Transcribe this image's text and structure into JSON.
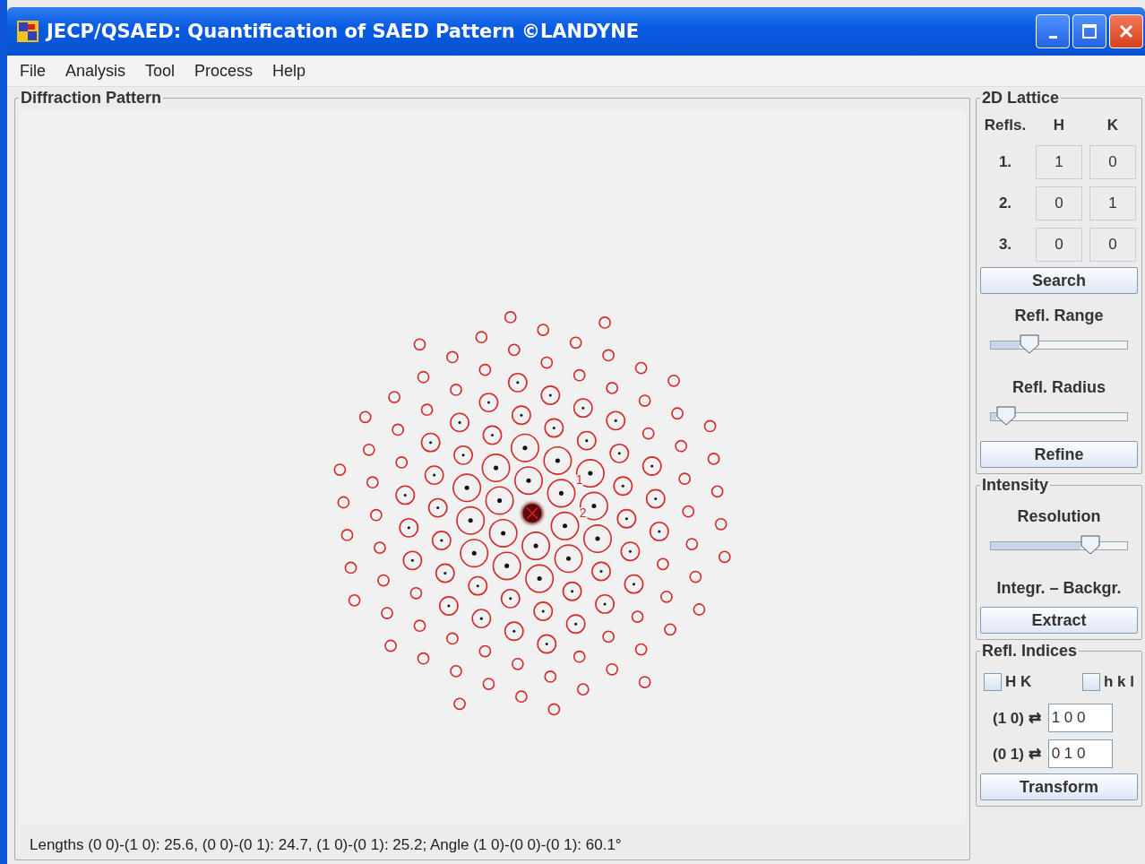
{
  "window": {
    "title": "JECP/QSAED: Quantification of SAED Pattern ©LANDYNE"
  },
  "menu": [
    {
      "label": "File"
    },
    {
      "label": "Analysis"
    },
    {
      "label": "Tool"
    },
    {
      "label": "Process"
    },
    {
      "label": "Help"
    }
  ],
  "pattern_panel": {
    "title": "Diffraction Pattern",
    "markers": [
      "1",
      "2"
    ],
    "status": "Lengths (0 0)-(1 0): 25.6, (0 0)-(0 1): 24.7, (1 0)-(0 1): 25.2; Angle (1 0)-(0 0)-(0 1): 60.1°"
  },
  "lattice_panel": {
    "title": "2D Lattice",
    "headers": [
      "Refls.",
      "H",
      "K"
    ],
    "rows": [
      {
        "label": "1.",
        "h": "1",
        "k": "0"
      },
      {
        "label": "2.",
        "h": "0",
        "k": "1"
      },
      {
        "label": "3.",
        "h": "0",
        "k": "0"
      }
    ],
    "search_button": "Search",
    "range": {
      "label": "Refl. Range",
      "level": 0.28
    },
    "radius": {
      "label": "Refl. Radius",
      "level": 0.11
    },
    "refine_button": "Refine"
  },
  "intensity_panel": {
    "title": "Intensity",
    "resolution": {
      "label": "Resolution",
      "level": 0.73
    },
    "mode_label": "Integr. – Backgr.",
    "extract_button": "Extract"
  },
  "indices_panel": {
    "title": "Refl. Indices",
    "options": [
      {
        "label": "H K",
        "checked": false
      },
      {
        "label": "h k l",
        "checked": false
      }
    ],
    "mappings": [
      {
        "label": "(1 0) ⇄",
        "value": "1 0 0"
      },
      {
        "label": "(0 1) ⇄",
        "value": "0 1 0"
      }
    ],
    "transform_button": "Transform"
  }
}
